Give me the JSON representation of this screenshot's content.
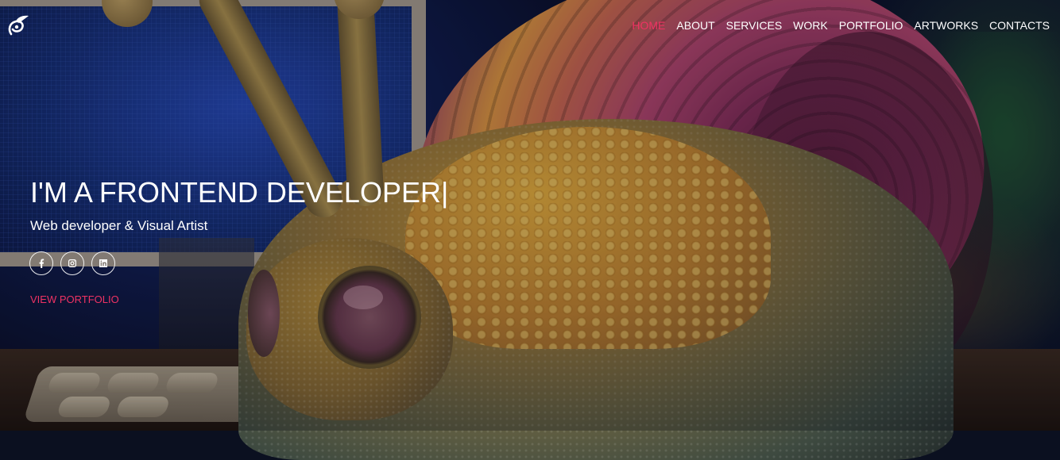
{
  "nav": {
    "items": [
      {
        "label": "HOME",
        "active": true
      },
      {
        "label": "ABOUT"
      },
      {
        "label": "SERVICES"
      },
      {
        "label": "WORK"
      },
      {
        "label": "PORTFOLIO"
      },
      {
        "label": "ARTWORKS"
      },
      {
        "label": "CONTACTS"
      }
    ]
  },
  "hero": {
    "title": "I'M A FRONTEND DEVELOPER|",
    "subtitle": "Web developer & Visual Artist",
    "socials": [
      {
        "icon": "facebook-icon"
      },
      {
        "icon": "instagram-icon"
      },
      {
        "icon": "linkedin-icon"
      }
    ],
    "cta_label": "VIEW PORTFOLIO"
  },
  "colors": {
    "accent": "#ef3263",
    "text": "#ffffff"
  }
}
